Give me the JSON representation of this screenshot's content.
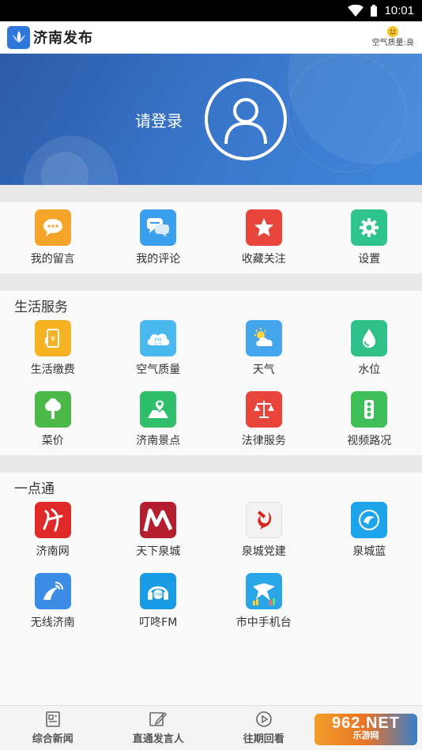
{
  "status_bar": {
    "time": "10:01"
  },
  "app_bar": {
    "title": "济南发布",
    "air_quality": "空气质量:良"
  },
  "banner": {
    "login_text": "请登录"
  },
  "quick_actions": [
    {
      "label": "我的留言",
      "icon": "chat-bubble-icon",
      "color": "#f5a52a"
    },
    {
      "label": "我的评论",
      "icon": "comment-icon",
      "color": "#3aa0ee"
    },
    {
      "label": "收藏关注",
      "icon": "star-icon",
      "color": "#e8453c"
    },
    {
      "label": "设置",
      "icon": "gear-icon",
      "color": "#2fc48b"
    }
  ],
  "life_services": {
    "title": "生活服务",
    "items": [
      {
        "label": "生活缴费",
        "icon": "bill-payment-icon",
        "color": "#f5b324"
      },
      {
        "label": "空气质量",
        "icon": "pm25-cloud-icon",
        "color": "#48b8ef"
      },
      {
        "label": "天气",
        "icon": "weather-icon",
        "color": "#46a6ec"
      },
      {
        "label": "水位",
        "icon": "water-drop-icon",
        "color": "#2fc189"
      },
      {
        "label": "菜价",
        "icon": "vegetable-icon",
        "color": "#4cb848"
      },
      {
        "label": "济南景点",
        "icon": "map-pin-icon",
        "color": "#2fbf6a"
      },
      {
        "label": "法律服务",
        "icon": "scales-icon",
        "color": "#e8453c"
      },
      {
        "label": "视频路况",
        "icon": "traffic-light-icon",
        "color": "#3fbf57"
      }
    ]
  },
  "one_point": {
    "title": "一点通",
    "items": [
      {
        "label": "济南网",
        "icon": "jinan-net-icon",
        "color": "#e02a2a"
      },
      {
        "label": "天下泉城",
        "icon": "tianxia-quancheng-icon",
        "color": "#b51e2e"
      },
      {
        "label": "泉城党建",
        "icon": "party-emblem-icon",
        "color": "#d6261c"
      },
      {
        "label": "泉城蓝",
        "icon": "quancheng-blue-icon",
        "color": "#1ea4ea"
      },
      {
        "label": "无线济南",
        "icon": "wireless-jinan-icon",
        "color": "#3d8de6"
      },
      {
        "label": "叮咚FM",
        "icon": "dingdong-fm-icon",
        "color": "#1a9be6"
      },
      {
        "label": "市中手机台",
        "icon": "shizhong-tv-icon",
        "color": "#2aa6e8"
      }
    ]
  },
  "bottom_tabs": [
    {
      "label": "综合新闻",
      "icon": "news-doc-icon"
    },
    {
      "label": "直通发言人",
      "icon": "edit-icon"
    },
    {
      "label": "往期回看",
      "icon": "play-circle-icon"
    }
  ],
  "watermark": {
    "big": "962.NET",
    "small": "乐游网"
  }
}
